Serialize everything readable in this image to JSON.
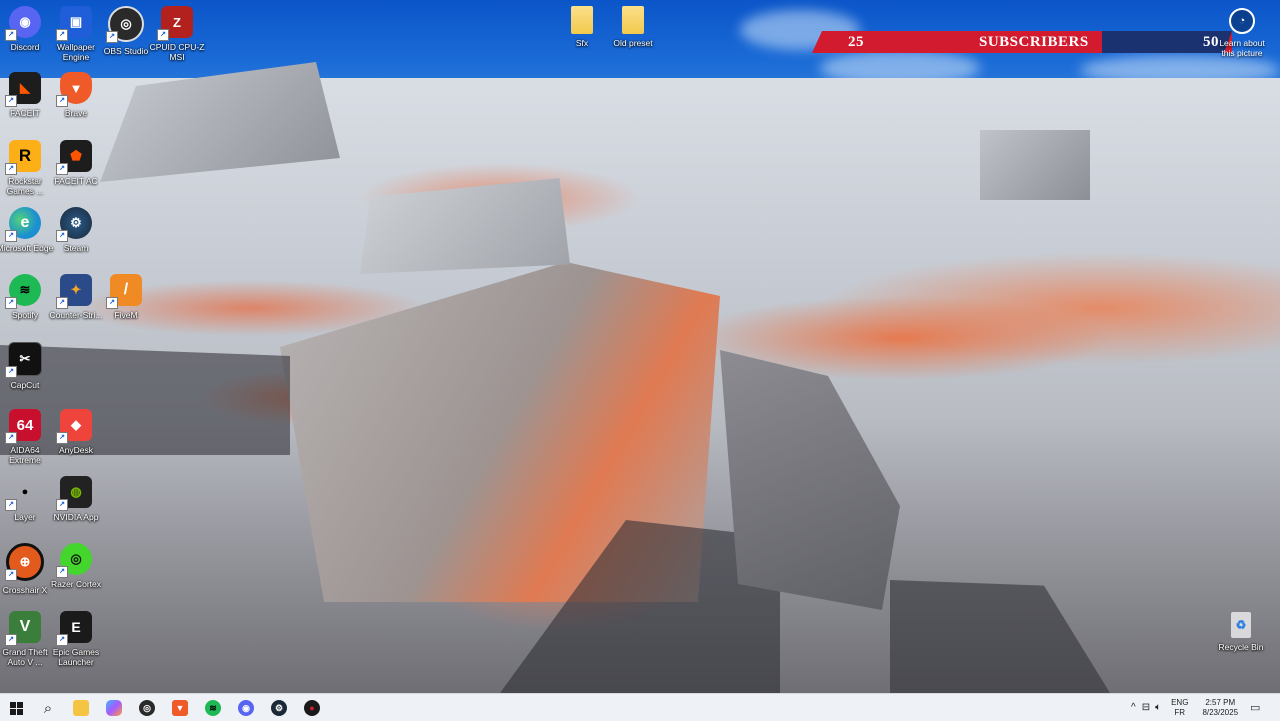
{
  "desktop": {
    "icons": [
      {
        "label": "Discord",
        "icon": "discord-icon",
        "color": "#5865f2",
        "glyph": "◉"
      },
      {
        "label": "Wallpaper Engine",
        "icon": "wallpaper-engine-icon",
        "color": "#1f5ed8",
        "glyph": "▣"
      },
      {
        "label": "OBS Studio",
        "icon": "obs-studio-icon",
        "color": "#2a2a2a",
        "glyph": "◎"
      },
      {
        "label": "CPUID CPU-Z MSI",
        "icon": "cpu-z-icon",
        "color": "#b3211e",
        "glyph": "Z"
      },
      {
        "label": "FACEIT",
        "icon": "faceit-icon",
        "color": "#1d1d1d",
        "glyph": "◣"
      },
      {
        "label": "Brave",
        "icon": "brave-icon",
        "color": "#f05a28",
        "glyph": "▼"
      },
      {
        "label": "Rockstar Games ...",
        "icon": "rockstar-icon",
        "color": "#fcaf17",
        "glyph": "R"
      },
      {
        "label": "FACEIT AC",
        "icon": "faceit-ac-icon",
        "color": "#1d1d1d",
        "glyph": "⬟"
      },
      {
        "label": "Microsoft Edge",
        "icon": "edge-icon",
        "color": "#1b8fd1",
        "glyph": "e"
      },
      {
        "label": "Steam",
        "icon": "steam-icon",
        "color": "#1b2838",
        "glyph": "⚙"
      },
      {
        "label": "Spotify",
        "icon": "spotify-icon",
        "color": "#1db954",
        "glyph": "≋"
      },
      {
        "label": "Counter-Stri...",
        "icon": "counter-strike-icon",
        "color": "#2b4a8a",
        "glyph": "✦"
      },
      {
        "label": "FiveM",
        "icon": "fivem-icon",
        "color": "#f08a24",
        "glyph": "/"
      },
      {
        "label": "CapCut",
        "icon": "capcut-icon",
        "color": "#111111",
        "glyph": "✂"
      },
      {
        "label": "AIDA64 Extreme",
        "icon": "aida64-icon",
        "color": "#c8102e",
        "glyph": "64"
      },
      {
        "label": "AnyDesk",
        "icon": "anydesk-icon",
        "color": "#ef443b",
        "glyph": "◆"
      },
      {
        "label": "Layer",
        "icon": "layer-icon",
        "color": "transparent",
        "glyph": "●"
      },
      {
        "label": "NVIDIA App",
        "icon": "nvidia-icon",
        "color": "#222222",
        "glyph": "◍"
      },
      {
        "label": "Crosshair X",
        "icon": "crosshair-x-icon",
        "color": "#e25a1c",
        "glyph": "⊕"
      },
      {
        "label": "Razer Cortex",
        "icon": "razer-cortex-icon",
        "color": "#44d62c",
        "glyph": "◎"
      },
      {
        "label": "Grand Theft Auto V ...",
        "icon": "gta-v-icon",
        "color": "#3b7d3b",
        "glyph": "V"
      },
      {
        "label": "Epic Games Launcher",
        "icon": "epic-games-icon",
        "color": "#1a1a1a",
        "glyph": "E"
      }
    ],
    "folders": [
      {
        "label": "Sfx",
        "icon": "folder-icon"
      },
      {
        "label": "Old preset",
        "icon": "folder-icon"
      }
    ],
    "recycle_bin": {
      "label": "Recycle Bin",
      "icon": "recycle-bin-icon"
    },
    "learn_about": {
      "label": "Learn about this picture",
      "icon": "camera-info-icon"
    }
  },
  "subscriber_banner": {
    "current": "25",
    "label": "SUBSCRIBERS",
    "goal": "50",
    "accent": "#d21b2e",
    "goal_color": "#1b3270"
  },
  "taskbar": {
    "apps": [
      {
        "name": "start",
        "icon": "windows-start-icon",
        "color": "#1a6fd6"
      },
      {
        "name": "search",
        "icon": "search-icon",
        "color": "#333333"
      },
      {
        "name": "file-explorer",
        "icon": "file-explorer-icon",
        "color": "#f4c542"
      },
      {
        "name": "copilot",
        "icon": "copilot-icon",
        "color": "#6b6bff"
      },
      {
        "name": "obs",
        "icon": "obs-studio-icon",
        "color": "#2a2a2a"
      },
      {
        "name": "brave",
        "icon": "brave-icon",
        "color": "#f05a28"
      },
      {
        "name": "spotify",
        "icon": "spotify-icon",
        "color": "#1db954"
      },
      {
        "name": "discord",
        "icon": "discord-icon",
        "color": "#5865f2"
      },
      {
        "name": "steam",
        "icon": "steam-icon",
        "color": "#1b2838"
      },
      {
        "name": "recording",
        "icon": "record-icon",
        "color": "#d21b2e"
      }
    ],
    "tray": {
      "language_line1": "ENG",
      "language_line2": "FR",
      "time": "2:57 PM",
      "date": "8/23/2025"
    }
  }
}
